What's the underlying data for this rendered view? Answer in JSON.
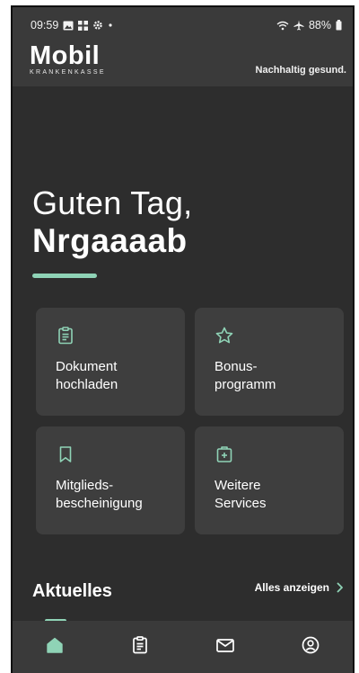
{
  "status_bar": {
    "time": "09:59",
    "battery": "88%",
    "left_icons": [
      "image-icon",
      "grid-icon",
      "settings-icon",
      "dot-icon"
    ],
    "right_icons": [
      "wifi-icon",
      "airplane-icon",
      "battery-icon"
    ]
  },
  "header": {
    "logo_word": "Mobil",
    "logo_sub": "KRANKENKASSE",
    "slogan": "Nachhaltig gesund."
  },
  "greeting": {
    "line1": "Guten Tag,",
    "name": "Nrgaaaab"
  },
  "cards": [
    {
      "icon": "clipboard-icon",
      "line1": "Dokument",
      "line2": "hochladen"
    },
    {
      "icon": "star-icon",
      "line1": "Bonus-",
      "line2": "programm"
    },
    {
      "icon": "bookmark-icon",
      "line1": "Mitglieds-",
      "line2": "bescheinigung"
    },
    {
      "icon": "medical-box-icon",
      "line1": "Weitere",
      "line2": "Services"
    }
  ],
  "news": {
    "title": "Aktuelles",
    "show_all": "Alles anzeigen"
  },
  "bottom_nav": [
    {
      "icon": "home-icon",
      "active": true
    },
    {
      "icon": "documents-icon",
      "active": false
    },
    {
      "icon": "mail-icon",
      "active": false
    },
    {
      "icon": "profile-icon",
      "active": false
    }
  ],
  "colors": {
    "accent": "#8fd3b6",
    "background": "#2d2d2d",
    "bar": "#3a3a3a",
    "card": "#3e3e3e"
  }
}
